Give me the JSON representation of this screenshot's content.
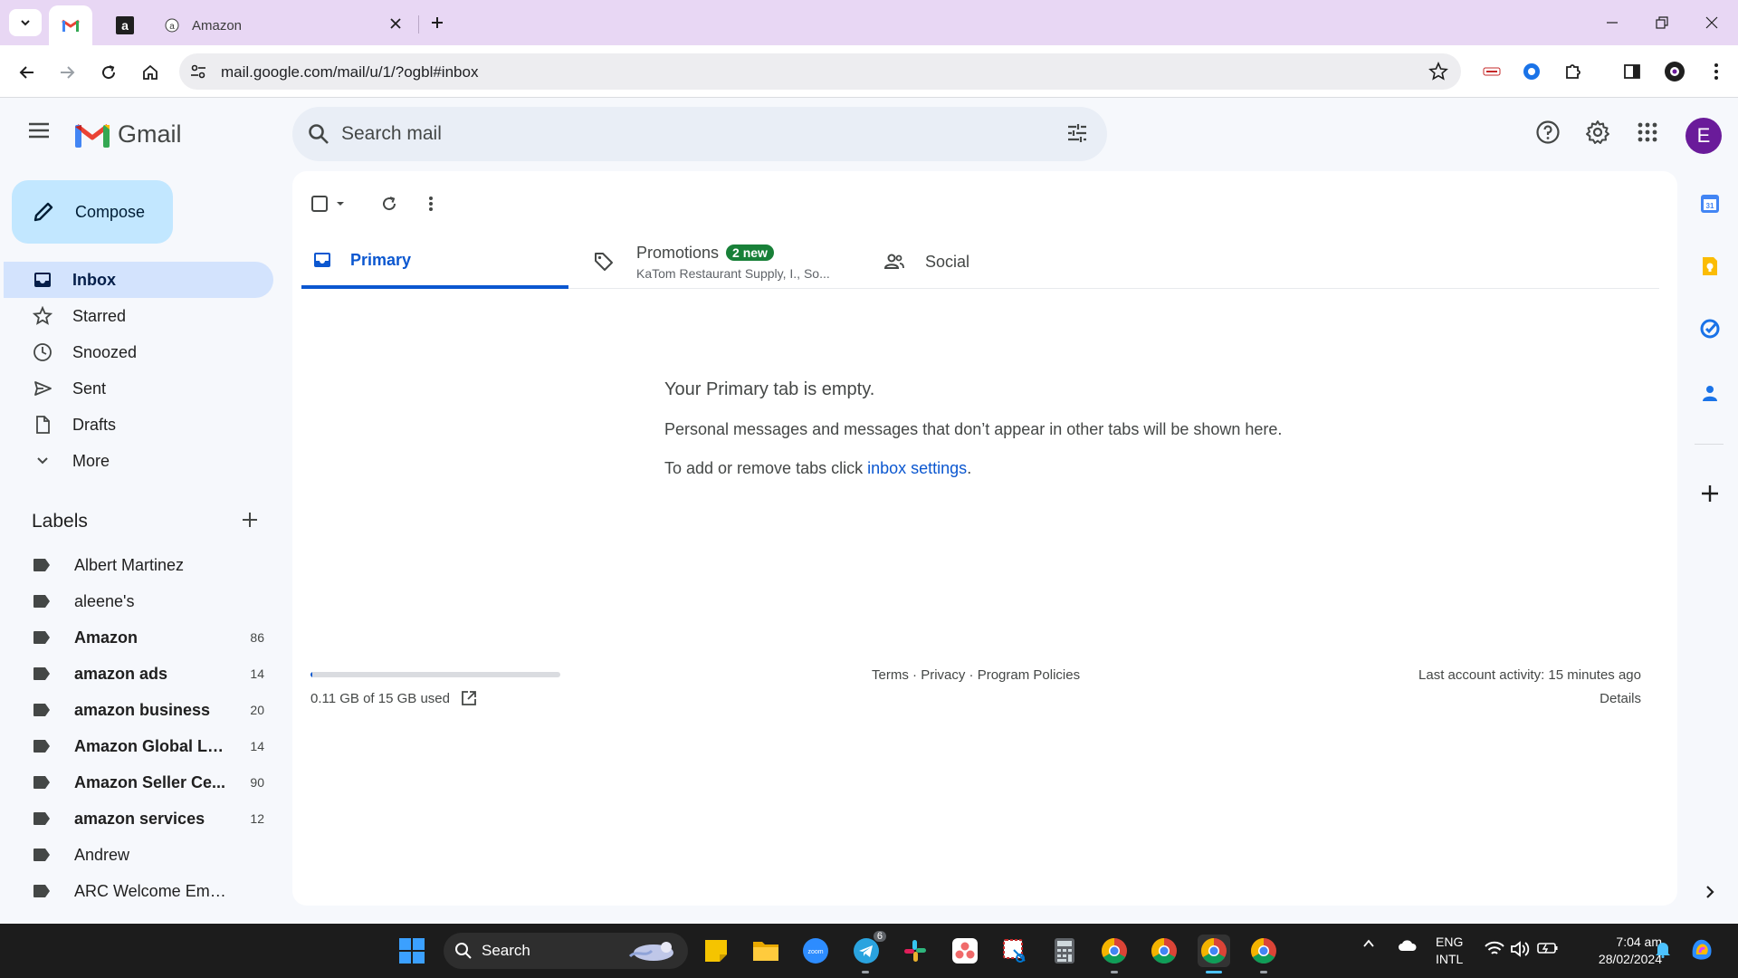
{
  "browser": {
    "tabs": [
      {
        "title": "",
        "icon": "gmail-icon"
      },
      {
        "title": "",
        "icon": "amazon-a-icon"
      },
      {
        "title": "Amazon",
        "icon": "amazon-icon"
      }
    ],
    "url": "mail.google.com/mail/u/1/?ogbl#inbox"
  },
  "gmail": {
    "brand": "Gmail",
    "search_placeholder": "Search mail",
    "avatar_letter": "E",
    "compose_label": "Compose",
    "nav": [
      {
        "label": "Inbox",
        "icon": "inbox-icon",
        "active": true
      },
      {
        "label": "Starred",
        "icon": "star-icon"
      },
      {
        "label": "Snoozed",
        "icon": "clock-icon"
      },
      {
        "label": "Sent",
        "icon": "send-icon"
      },
      {
        "label": "Drafts",
        "icon": "draft-icon"
      },
      {
        "label": "More",
        "icon": "chevron-down-icon"
      }
    ],
    "labels_title": "Labels",
    "labels": [
      {
        "name": "Albert Martinez",
        "count": "",
        "bold": false
      },
      {
        "name": "aleene's",
        "count": "",
        "bold": false
      },
      {
        "name": "Amazon",
        "count": "86",
        "bold": true
      },
      {
        "name": "amazon ads",
        "count": "14",
        "bold": true
      },
      {
        "name": "amazon business",
        "count": "20",
        "bold": true
      },
      {
        "name": "Amazon Global Lo...",
        "count": "14",
        "bold": true
      },
      {
        "name": "Amazon Seller Ce...",
        "count": "90",
        "bold": true
      },
      {
        "name": "amazon services",
        "count": "12",
        "bold": true
      },
      {
        "name": "Andrew",
        "count": "",
        "bold": false
      },
      {
        "name": "ARC Welcome Emails",
        "count": "",
        "bold": false
      }
    ],
    "tabs": {
      "primary": "Primary",
      "promotions": "Promotions",
      "promotions_badge": "2 new",
      "promotions_snippet": "KaTom Restaurant Supply, I., So...",
      "social": "Social"
    },
    "empty": {
      "heading": "Your Primary tab is empty.",
      "line1": "Personal messages and messages that don’t appear in other tabs will be shown here.",
      "line2_prefix": "To add or remove tabs click ",
      "line2_link": "inbox settings",
      "line2_suffix": "."
    },
    "footer": {
      "storage_text": "0.11 GB of 15 GB used",
      "storage_fraction": 0.0073,
      "terms": "Terms",
      "privacy": "Privacy",
      "policies": "Program Policies",
      "separator": " · ",
      "last_activity": "Last account activity: 15 minutes ago",
      "details": "Details"
    }
  },
  "taskbar": {
    "search_label": "Search",
    "telegram_badge": "6",
    "lang_line1": "ENG",
    "lang_line2": "INTL",
    "time": "7:04 am",
    "date": "28/02/2024"
  },
  "colors": {
    "accent": "#0b57d0",
    "compose_bg": "#c2e7ff",
    "active_nav_bg": "#d3e3fd",
    "badge_green": "#188038",
    "tabstrip": "#e8d7f4"
  }
}
